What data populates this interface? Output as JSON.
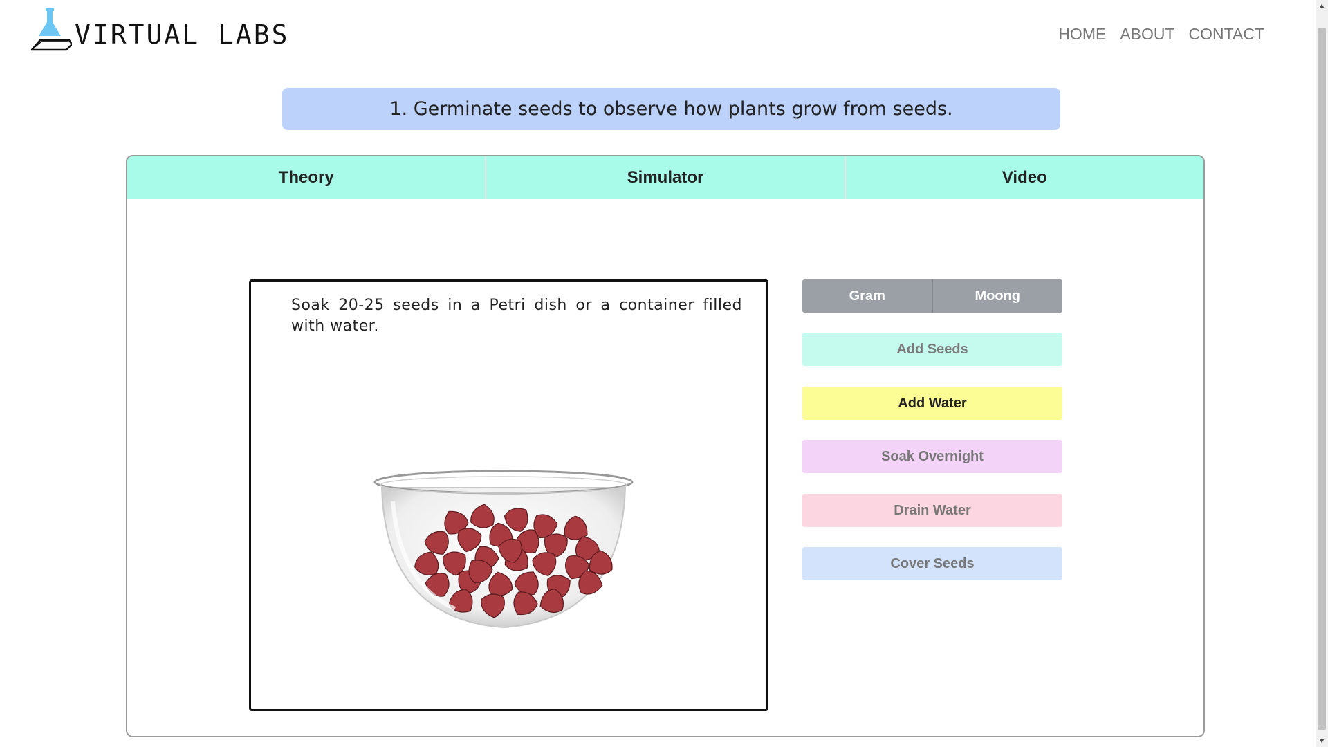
{
  "header": {
    "logo_text": "VIRTUAL LABS",
    "nav": [
      "HOME",
      "ABOUT",
      "CONTACT"
    ]
  },
  "experiment": {
    "title": "1. Germinate seeds to observe how plants grow from seeds."
  },
  "tabs": [
    {
      "label": "Theory"
    },
    {
      "label": "Simulator"
    },
    {
      "label": "Video"
    }
  ],
  "simulator": {
    "instruction": "Soak 20-25 seeds in a Petri dish or a container filled with water.",
    "seed_options": [
      "Gram",
      "Moong"
    ],
    "actions": {
      "add_seeds": "Add Seeds",
      "add_water": "Add Water",
      "soak_overnight": "Soak Overnight",
      "drain_water": "Drain Water",
      "cover_seeds": "Cover Seeds"
    }
  },
  "colors": {
    "title_banner": "#bcd2fb",
    "tab_bar": "#a8fbe9",
    "seed_toggle": "#9aa0a6",
    "add_seeds": "#c5fbee",
    "add_water": "#fdfd96",
    "soak_overnight": "#f4d3f9",
    "drain_water": "#fcd6e0",
    "cover_seeds": "#d3e3fb",
    "seed": "#a83a40"
  }
}
